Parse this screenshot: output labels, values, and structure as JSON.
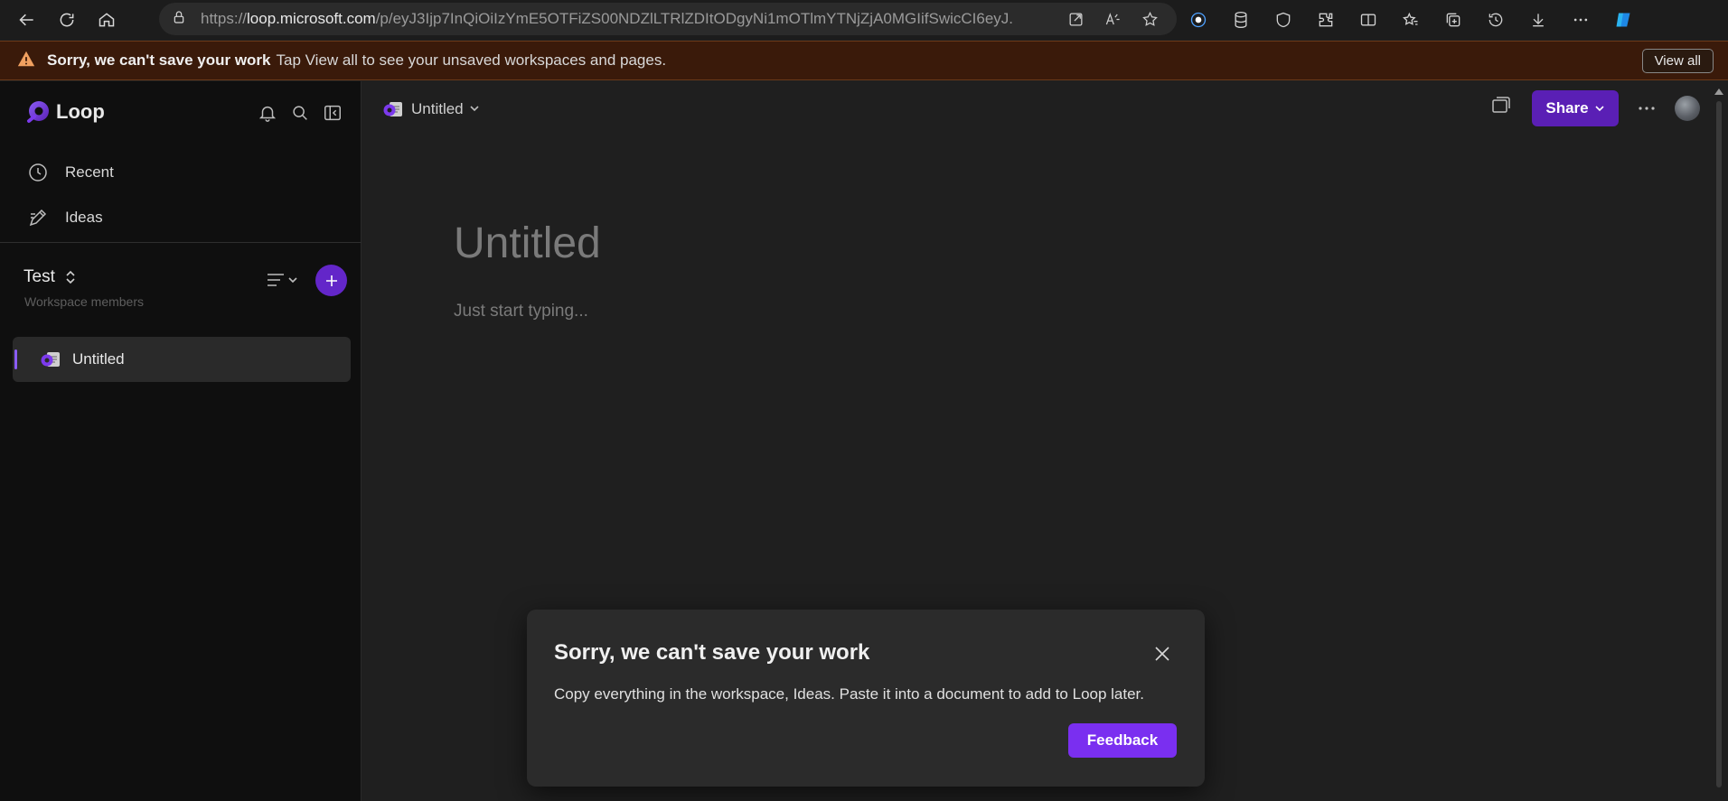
{
  "browser": {
    "url_prefix": "https://",
    "url_domain": "loop.microsoft.com",
    "url_rest": "/p/eyJ3Ijp7InQiOiIzYmE5OTFiZS00NDZlLTRlZDItODgyNi1mOTlmYTNjZjA0MGIifSwicCI6eyJ..."
  },
  "banner": {
    "title": "Sorry, we can't save your work",
    "text": "Tap View all to see your unsaved workspaces and pages.",
    "view_all": "View all",
    "color": "#3a1a0a"
  },
  "sidebar": {
    "app_name": "Loop",
    "nav": [
      {
        "label": "Recent",
        "icon": "clock-icon"
      },
      {
        "label": "Ideas",
        "icon": "ideas-icon"
      }
    ],
    "workspace": {
      "name": "Test",
      "subtitle": "Workspace members"
    },
    "pages": [
      {
        "label": "Untitled"
      }
    ]
  },
  "header": {
    "breadcrumb": "Untitled",
    "share": "Share"
  },
  "document": {
    "title": "Untitled",
    "placeholder": "Just start typing..."
  },
  "modal": {
    "title": "Sorry, we can't save your work",
    "body": "Copy everything in the workspace, Ideas. Paste it into a document to add to Loop later.",
    "feedback": "Feedback"
  },
  "colors": {
    "accent": "#7a2ff0",
    "share": "#5a1fb5",
    "sidebar_bg": "#0f0f0f",
    "main_bg": "#1f1f1f"
  }
}
